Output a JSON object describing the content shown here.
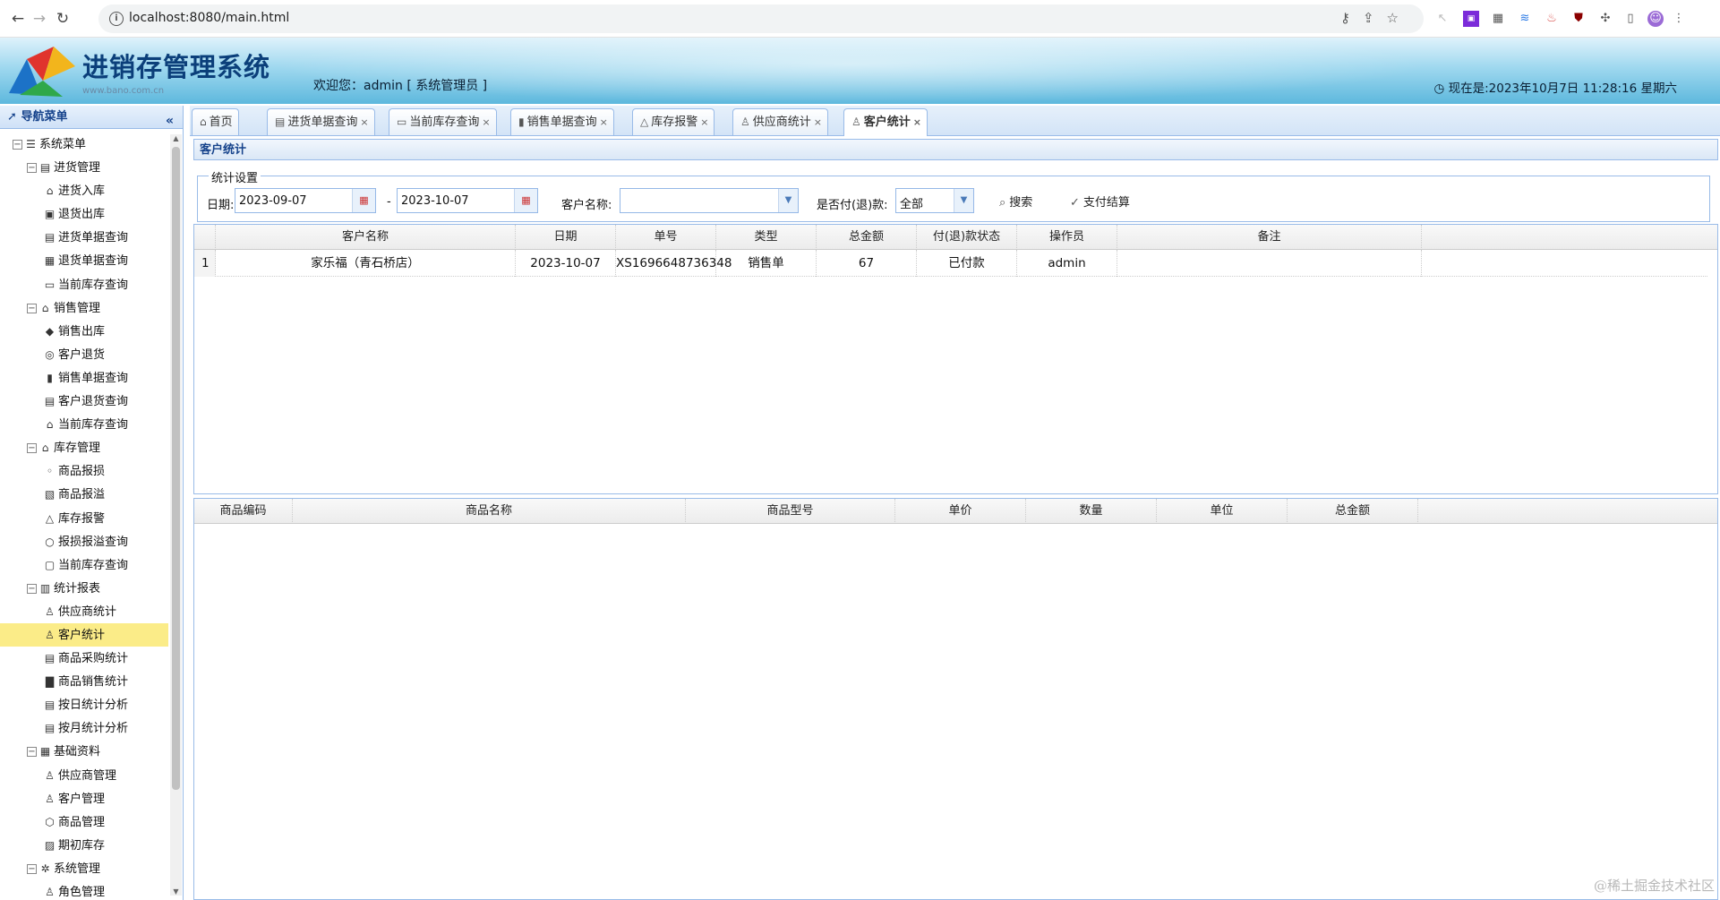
{
  "browser": {
    "url": "localhost:8080/main.html"
  },
  "header": {
    "title": "进销存管理系统",
    "site_url": "www.bano.com.cn",
    "welcome": "欢迎您：admin [ 系统管理员 ]",
    "datetime": "现在是:2023年10月7日 11:28:16 星期六"
  },
  "sidebar": {
    "title": "导航菜单",
    "tree": [
      {
        "label": "系统菜单",
        "level": 0,
        "expander": "⊟",
        "icon": "☰"
      },
      {
        "label": "进货管理",
        "level": 1,
        "expander": "⊟",
        "icon": "▤"
      },
      {
        "label": "进货入库",
        "level": 2,
        "icon": "⌂"
      },
      {
        "label": "退货出库",
        "level": 2,
        "icon": "▣"
      },
      {
        "label": "进货单据查询",
        "level": 2,
        "icon": "▤"
      },
      {
        "label": "退货单据查询",
        "level": 2,
        "icon": "▦"
      },
      {
        "label": "当前库存查询",
        "level": 2,
        "icon": "▭"
      },
      {
        "label": "销售管理",
        "level": 1,
        "expander": "⊟",
        "icon": "⌂"
      },
      {
        "label": "销售出库",
        "level": 2,
        "icon": "◆"
      },
      {
        "label": "客户退货",
        "level": 2,
        "icon": "◎"
      },
      {
        "label": "销售单据查询",
        "level": 2,
        "icon": "▮"
      },
      {
        "label": "客户退货查询",
        "level": 2,
        "icon": "▤"
      },
      {
        "label": "当前库存查询",
        "level": 2,
        "icon": "⌂"
      },
      {
        "label": "库存管理",
        "level": 1,
        "expander": "⊟",
        "icon": "⌂"
      },
      {
        "label": "商品报损",
        "level": 2,
        "icon": "◦"
      },
      {
        "label": "商品报溢",
        "level": 2,
        "icon": "▧"
      },
      {
        "label": "库存报警",
        "level": 2,
        "icon": "△"
      },
      {
        "label": "报损报溢查询",
        "level": 2,
        "icon": "○"
      },
      {
        "label": "当前库存查询",
        "level": 2,
        "icon": "▢"
      },
      {
        "label": "统计报表",
        "level": 1,
        "expander": "⊟",
        "icon": "▥"
      },
      {
        "label": "供应商统计",
        "level": 2,
        "icon": "♙"
      },
      {
        "label": "客户统计",
        "level": 2,
        "icon": "♙",
        "selected": true
      },
      {
        "label": "商品采购统计",
        "level": 2,
        "icon": "▤"
      },
      {
        "label": "商品销售统计",
        "level": 2,
        "icon": "▇"
      },
      {
        "label": "按日统计分析",
        "level": 2,
        "icon": "▤"
      },
      {
        "label": "按月统计分析",
        "level": 2,
        "icon": "▤"
      },
      {
        "label": "基础资料",
        "level": 1,
        "expander": "⊟",
        "icon": "▦"
      },
      {
        "label": "供应商管理",
        "level": 2,
        "icon": "♙"
      },
      {
        "label": "客户管理",
        "level": 2,
        "icon": "♙"
      },
      {
        "label": "商品管理",
        "level": 2,
        "icon": "⬡"
      },
      {
        "label": "期初库存",
        "level": 2,
        "icon": "▨"
      },
      {
        "label": "系统管理",
        "level": 1,
        "expander": "⊟",
        "icon": "✲"
      },
      {
        "label": "角色管理",
        "level": 2,
        "icon": "♙"
      }
    ]
  },
  "tabs": [
    {
      "label": "首页",
      "icon": "⌂",
      "closable": false
    },
    {
      "label": "进货单据查询",
      "icon": "▤",
      "closable": true
    },
    {
      "label": "当前库存查询",
      "icon": "▭",
      "closable": true
    },
    {
      "label": "销售单据查询",
      "icon": "▮",
      "closable": true
    },
    {
      "label": "库存报警",
      "icon": "△",
      "closable": true
    },
    {
      "label": "供应商统计",
      "icon": "♙",
      "closable": true
    },
    {
      "label": "客户统计",
      "icon": "♙",
      "closable": true,
      "active": true
    }
  ],
  "panel": {
    "title": "客户统计",
    "filter": {
      "legend": "统计设置",
      "date_label": "日期:",
      "date_from": "2023-09-07",
      "date_sep": "-",
      "date_to": "2023-10-07",
      "customer_label": "客户名称:",
      "customer_value": "",
      "paid_label": "是否付(退)款:",
      "paid_value": "全部",
      "search_button": "搜索",
      "settle_button": "支付结算"
    },
    "orders": {
      "columns": [
        "",
        "客户名称",
        "日期",
        "单号",
        "类型",
        "总金额",
        "付(退)款状态",
        "操作员",
        "备注"
      ],
      "rows": [
        [
          "1",
          "家乐福（青石桥店）",
          "2023-10-07",
          "XS1696648736348",
          "销售单",
          "67",
          "已付款",
          "admin",
          ""
        ]
      ]
    },
    "items": {
      "columns": [
        "商品编码",
        "商品名称",
        "商品型号",
        "单价",
        "数量",
        "单位",
        "总金额"
      ],
      "rows": []
    }
  },
  "watermark": "@稀土掘金技术社区"
}
